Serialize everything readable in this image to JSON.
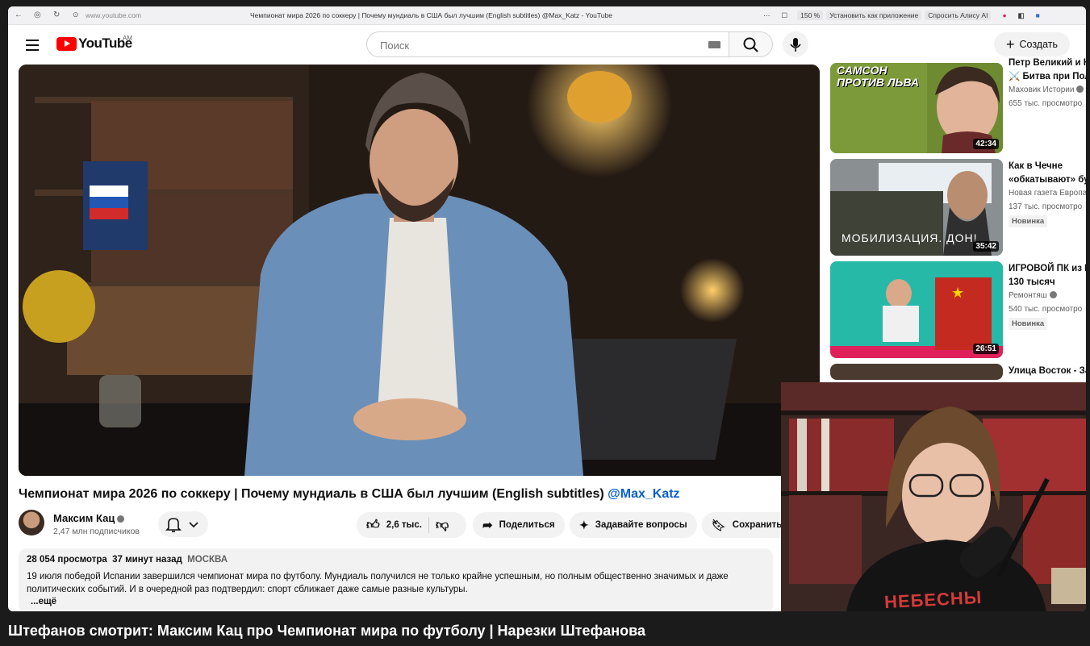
{
  "browser": {
    "url": "www.youtube.com",
    "tab_title": "Чемпионат мира 2026 по соккеру | Почему мундиаль в США был лучшим (English subtitles) @Max_Katz - YouTube",
    "zoom": "150 %",
    "install_label": "Установить как приложение",
    "alice_label": "Спросить Алису AI"
  },
  "header": {
    "logo_text": "YouTube",
    "region": "AM",
    "search_placeholder": "Поиск",
    "create_label": "Создать"
  },
  "video": {
    "title": "Чемпионат мира 2026 по соккеру | Почему мундиаль в США был лучшим (English subtitles)",
    "handle": "@Max_Katz",
    "channel_name": "Максим Кац",
    "subscribers": "2,47 млн подписчиков",
    "likes": "2,6 тыс.",
    "share_label": "Поделиться",
    "ask_label": "Задавайте вопросы",
    "save_label": "Сохранить"
  },
  "description": {
    "views": "28 054 просмотра",
    "time": "37 минут назад",
    "location": "МОСКВА",
    "text": "19 июля победой Испании завершился чемпионат мира по футболу. Мундиаль получился не только крайне успешным, но полным общественно значимых и даже политических событий. И в очередной раз подтвердил: спорт сближает даже самые разные культуры.",
    "more": "...ещё"
  },
  "recommendations": [
    {
      "title1": "Петр Великий и К",
      "title2": "⚔️ Битва при Пол",
      "channel": "Маховик Истории",
      "views": "655 тыс. просмотро",
      "duration": "42:34",
      "thumb_text": "САМСОН ПРОТИВ ЛЬВА",
      "badge": ""
    },
    {
      "title1": "Как в Чечне",
      "title2": "«обкатывают» бу",
      "channel": "Новая газета Европа",
      "views": "137 тыс. просмотро",
      "duration": "35:42",
      "thumb_text": "МОБИЛИЗАЦИЯ. ДОН!",
      "badge": "Новинка"
    },
    {
      "title1": "ИГРОВОЙ ПК из К",
      "title2": "130 тысяч",
      "channel": "Ремонтяш",
      "views": "540 тыс. просмотро",
      "duration": "26:51",
      "thumb_text": "",
      "badge": "Новинка"
    },
    {
      "title1": "Улица Восток - За",
      "title2": "",
      "channel": "",
      "views": "",
      "duration": "",
      "thumb_text": "",
      "badge": ""
    }
  ],
  "overlay": {
    "shirt_text": "НЕБЕСНЫ",
    "caption": "Штефанов смотрит: Максим Кац про Чемпионат мира по футболу | Нарезки Штефанова"
  }
}
